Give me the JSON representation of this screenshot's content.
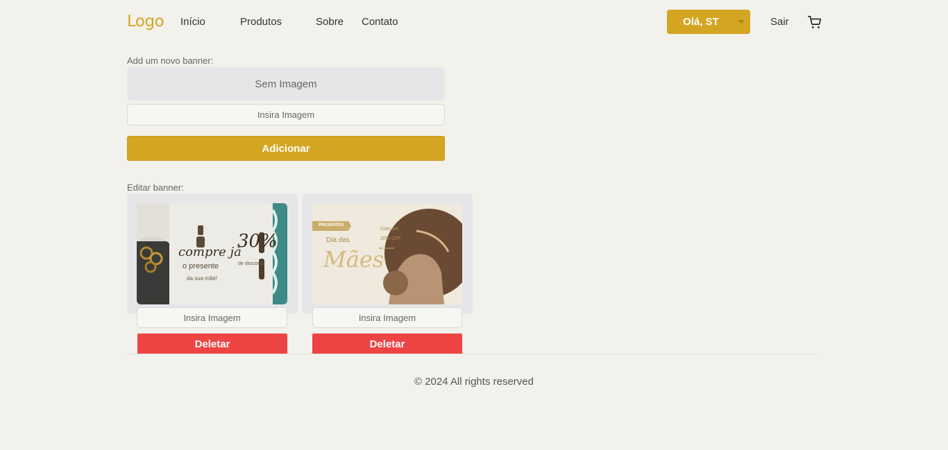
{
  "header": {
    "logo": "Logo",
    "nav": [
      "Início",
      "Produtos",
      "Sobre",
      "Contato"
    ],
    "user_greeting": "Olá, ST",
    "logout": "Sair",
    "cart_icon": "cart-icon"
  },
  "add_banner": {
    "label": "Add um novo banner:",
    "preview_text": "Sem Imagem",
    "input_placeholder": "Insira Imagem",
    "button": "Adicionar"
  },
  "edit_banner": {
    "label": "Editar banner:",
    "banners": [
      {
        "image_text": {
          "line1": "compre já",
          "line2": "o presente",
          "line3": "da sua mãe!",
          "percent": "30%",
          "sub": "de desconto"
        },
        "input_placeholder": "Insira Imagem",
        "delete_label": "Deletar"
      },
      {
        "image_text": {
          "tag": "PRESENTES",
          "line1": "Dia das",
          "line2": "Mães",
          "offer1": "Com até",
          "offer2": "20% OFF"
        },
        "input_placeholder": "Insira Imagem",
        "delete_label": "Deletar"
      }
    ]
  },
  "footer": "© 2024 All rights reserved",
  "colors": {
    "accent": "#d4a521",
    "danger": "#ef4444",
    "background": "#f2f1eb"
  }
}
